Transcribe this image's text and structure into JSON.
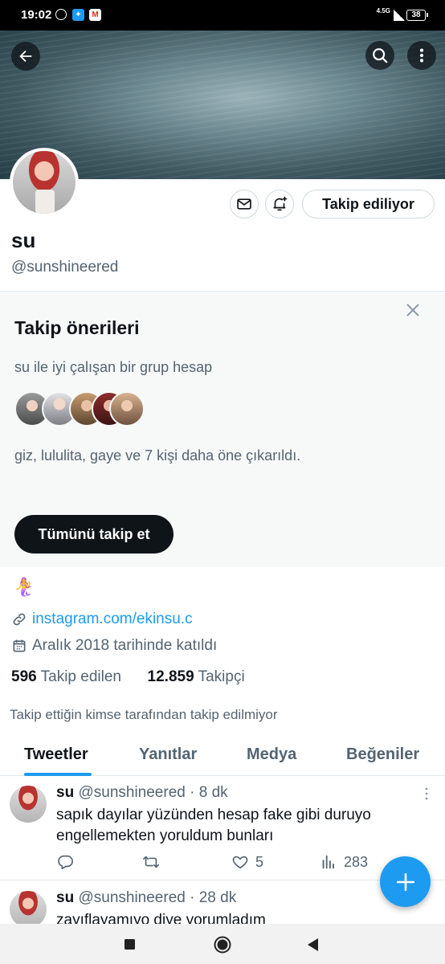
{
  "status_bar": {
    "time": "19:02",
    "network": "4.5G",
    "battery": "38",
    "notification_icons": [
      "alarm-icon",
      "twitter-icon",
      "gmail-icon"
    ]
  },
  "colors": {
    "accent": "#1d9bf0",
    "text": "#0f1419",
    "muted": "#536471",
    "border": "#cfd9de",
    "panel": "#f7f9f9"
  },
  "profile": {
    "display_name": "su",
    "handle": "@sunshineered",
    "follow_state_label": "Takip ediliyor",
    "bio_emoji": "🧜‍♀️",
    "link": "instagram.com/ekinsu.c",
    "joined": "Aralık 2018 tarihinde katıldı",
    "following_count": "596",
    "following_label": "Takip edilen",
    "followers_count": "12.859",
    "followers_label": "Takipçi",
    "followed_by_note": "Takip ettiğin kimse tarafından takip edilmiyor"
  },
  "suggestions": {
    "title": "Takip önerileri",
    "subtitle": "su ile iyi çalışan bir grup hesap",
    "names_line": "giz, lululita, gaye ve 7 kişi daha öne çıkarıldı.",
    "follow_all_label": "Tümünü takip et"
  },
  "tabs": [
    {
      "label": "Tweetler",
      "active": true
    },
    {
      "label": "Yanıtlar",
      "active": false
    },
    {
      "label": "Medya",
      "active": false
    },
    {
      "label": "Beğeniler",
      "active": false
    }
  ],
  "tweets": [
    {
      "name": "su",
      "handle": "@sunshineered",
      "time": "· 8 dk",
      "text": "sapık dayılar yüzünden hesap fake gibi duruyo engellemekten yoruldum bunları",
      "likes": "5",
      "views": "283"
    },
    {
      "name": "su",
      "handle": "@sunshineered",
      "time": "· 28 dk",
      "text": "zayıflayamıyo diye yorumladım"
    }
  ]
}
